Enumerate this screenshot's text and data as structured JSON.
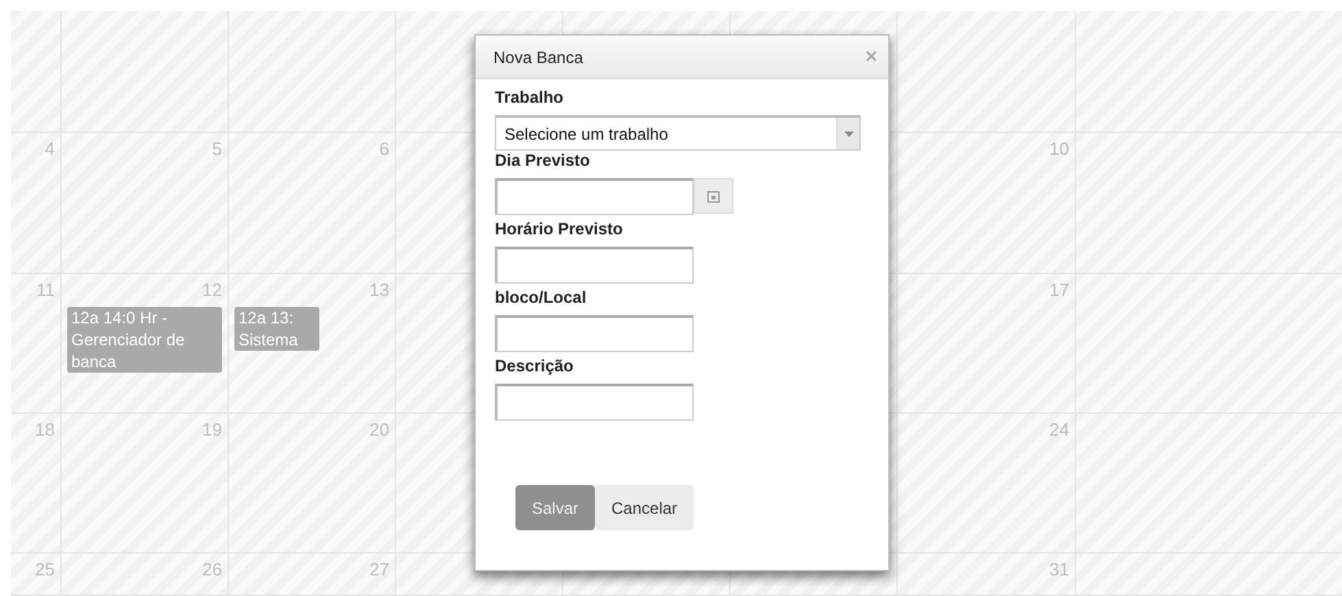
{
  "calendar": {
    "weeks": [
      {
        "days": [
          {
            "number": "4"
          },
          {
            "number": "5"
          },
          {
            "number": "6"
          }
        ],
        "last_day": {
          "number": "10"
        }
      },
      {
        "days": [
          {
            "number": "11"
          },
          {
            "number": "12",
            "events": [
              {
                "text": "12a 14:0 Hr - Gerenciador de banca"
              }
            ]
          },
          {
            "number": "13",
            "events": [
              {
                "text": "12a 13: Sistema"
              }
            ]
          }
        ],
        "last_day": {
          "number": "17"
        }
      },
      {
        "days": [
          {
            "number": "18"
          },
          {
            "number": "19"
          },
          {
            "number": "20"
          }
        ],
        "last_day": {
          "number": "24"
        }
      },
      {
        "days": [
          {
            "number": "25"
          },
          {
            "number": "26"
          },
          {
            "number": "27"
          }
        ],
        "last_day": {
          "number": "31"
        }
      }
    ]
  },
  "dialog": {
    "title": "Nova Banca",
    "close": "×",
    "fields": [
      {
        "kind": "select",
        "label": "Trabalho",
        "value": "Selecione um trabalho"
      },
      {
        "kind": "date",
        "label": "Dia Previsto"
      },
      {
        "kind": "text",
        "label": "Horário Previsto"
      },
      {
        "kind": "text",
        "label": "bloco/Local"
      },
      {
        "kind": "text",
        "label": "Descrição"
      }
    ],
    "buttons": [
      {
        "label": "Salvar",
        "primary": true
      },
      {
        "label": "Cancelar",
        "primary": false
      }
    ]
  }
}
